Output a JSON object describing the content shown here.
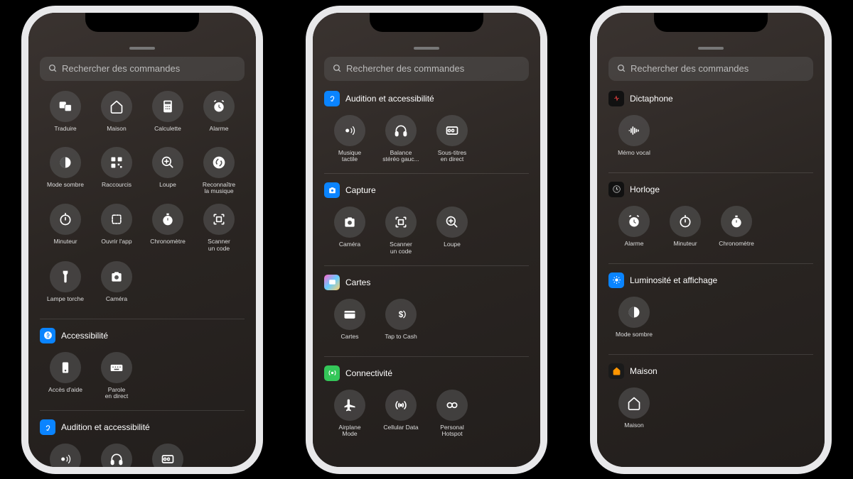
{
  "search_placeholder": "Rechercher des commandes",
  "phones": [
    {
      "top_items": [
        {
          "icon": "translate",
          "label": "Traduire"
        },
        {
          "icon": "home",
          "label": "Maison"
        },
        {
          "icon": "calc",
          "label": "Calculette"
        },
        {
          "icon": "alarm",
          "label": "Alarme"
        },
        {
          "icon": "dark",
          "label": "Mode sombre"
        },
        {
          "icon": "qr",
          "label": "Raccourcis"
        },
        {
          "icon": "magnify",
          "label": "Loupe"
        },
        {
          "icon": "shazam",
          "label": "Reconnaître\nla musique"
        },
        {
          "icon": "timer",
          "label": "Minuteur"
        },
        {
          "icon": "openapp",
          "label": "Ouvrir l'app"
        },
        {
          "icon": "stopwatch",
          "label": "Chronomètre"
        },
        {
          "icon": "scan",
          "label": "Scanner\nun code"
        },
        {
          "icon": "flashlight",
          "label": "Lampe torche"
        },
        {
          "icon": "camera",
          "label": "Caméra"
        }
      ],
      "sections": [
        {
          "badge": "blue",
          "badge_icon": "access",
          "title": "Accessibilité",
          "items": [
            {
              "icon": "assist",
              "label": "Accès d'aide"
            },
            {
              "icon": "keyboard",
              "label": "Parole\nen direct"
            }
          ]
        },
        {
          "badge": "blue",
          "badge_icon": "ear",
          "title": "Audition et accessibilité",
          "items": [
            {
              "icon": "haptic",
              "label": ""
            },
            {
              "icon": "headphones",
              "label": ""
            },
            {
              "icon": "cc",
              "label": ""
            }
          ]
        }
      ]
    },
    {
      "sections": [
        {
          "badge": "blue",
          "badge_icon": "ear",
          "title": "Audition et accessibilité",
          "items": [
            {
              "icon": "haptic",
              "label": "Musique\ntactile"
            },
            {
              "icon": "headphones",
              "label": "Balance\nstéréo gauc..."
            },
            {
              "icon": "cc",
              "label": "Sous-titres\nen direct"
            }
          ]
        },
        {
          "badge": "blue",
          "badge_icon": "camera",
          "title": "Capture",
          "items": [
            {
              "icon": "camera",
              "label": "Caméra"
            },
            {
              "icon": "scan",
              "label": "Scanner\nun code"
            },
            {
              "icon": "magnify",
              "label": "Loupe"
            }
          ]
        },
        {
          "badge": "wallet",
          "badge_icon": "wallet",
          "title": "Cartes",
          "items": [
            {
              "icon": "wallet",
              "label": "Cartes"
            },
            {
              "icon": "tapcash",
              "label": "Tap to Cash"
            }
          ]
        },
        {
          "badge": "green",
          "badge_icon": "connect",
          "title": "Connectivité",
          "items": [
            {
              "icon": "airplane",
              "label": "Airplane\nMode"
            },
            {
              "icon": "cellular",
              "label": "Cellular Data"
            },
            {
              "icon": "hotspot",
              "label": "Personal\nHotspot"
            }
          ]
        }
      ]
    },
    {
      "sections": [
        {
          "badge": "black",
          "badge_icon": "dicta",
          "title": "Dictaphone",
          "items": [
            {
              "icon": "wave",
              "label": "Mémo vocal"
            }
          ]
        },
        {
          "badge": "black",
          "badge_icon": "clock",
          "title": "Horloge",
          "items": [
            {
              "icon": "alarm",
              "label": "Alarme"
            },
            {
              "icon": "timer",
              "label": "Minuteur"
            },
            {
              "icon": "stopwatch",
              "label": "Chronomètre"
            }
          ]
        },
        {
          "badge": "brightness",
          "badge_icon": "sun",
          "title": "Luminosité et affichage",
          "items": [
            {
              "icon": "dark",
              "label": "Mode sombre"
            }
          ]
        },
        {
          "badge": "orange",
          "badge_icon": "home-orange",
          "title": "Maison",
          "items": [
            {
              "icon": "home",
              "label": "Maison"
            }
          ]
        }
      ]
    }
  ]
}
